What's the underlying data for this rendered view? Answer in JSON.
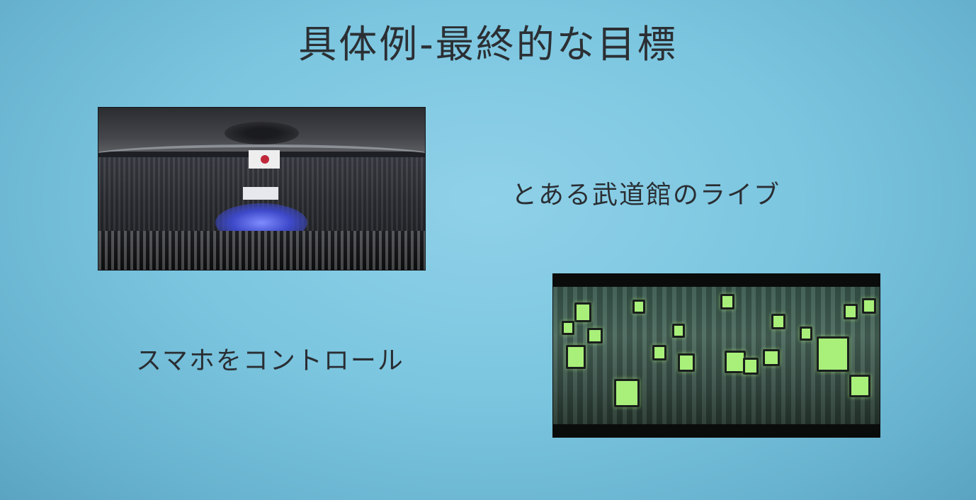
{
  "slide": {
    "title": "具体例-最終的な目標",
    "label_budokan": "とある武道館のライブ",
    "label_smartphone": "スマホをコントロール"
  },
  "colors": {
    "background": "#7cc6e0",
    "text": "#2b2f33",
    "phone_screen": "#a9f07a",
    "stage_glow": "#3d49c9"
  },
  "images": [
    {
      "name": "budokan-concert-photo",
      "depicts": "arena concert crowd with stage lighting"
    },
    {
      "name": "crowd-smartphones-photo",
      "depicts": "crowd holding glowing smartphones"
    }
  ]
}
